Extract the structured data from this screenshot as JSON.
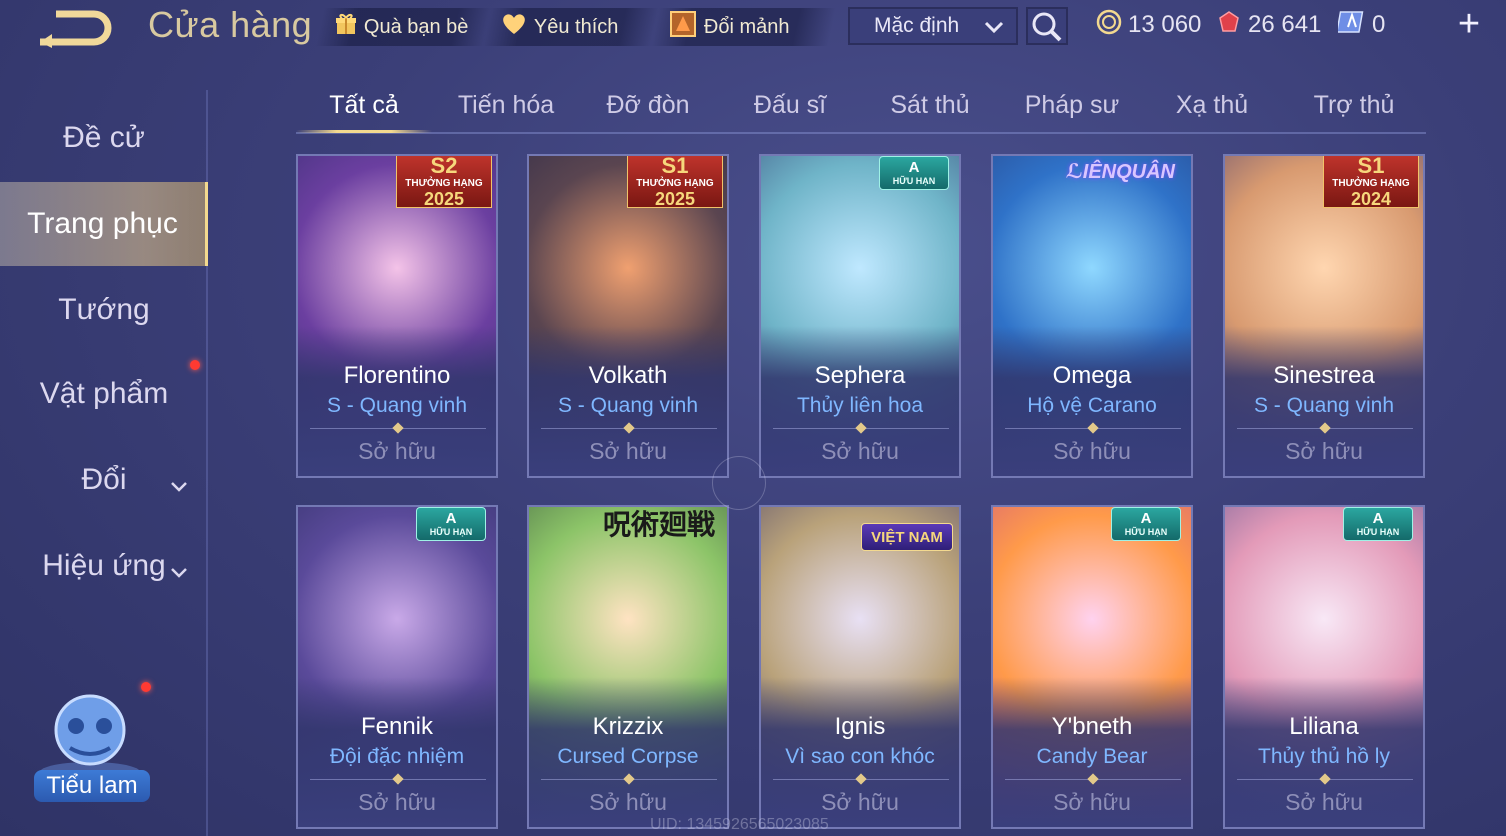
{
  "header": {
    "title": "Cửa hàng",
    "gift_label": "Quà bạn bè",
    "favorite_label": "Yêu thích",
    "exchange_label": "Đổi mảnh",
    "sort_value": "Mặc định"
  },
  "currency": {
    "gold": "13 060",
    "gems": "26 641",
    "vouchers": "0"
  },
  "sidebar": {
    "items": [
      {
        "label": "Đề cử"
      },
      {
        "label": "Trang phục"
      },
      {
        "label": "Tướng"
      },
      {
        "label": "Vật phẩm"
      },
      {
        "label": "Đổi"
      },
      {
        "label": "Hiệu ứng"
      }
    ],
    "mascot_label": "Tiểu lam"
  },
  "tabs": [
    {
      "label": "Tất cả"
    },
    {
      "label": "Tiến hóa"
    },
    {
      "label": "Đỡ đòn"
    },
    {
      "label": "Đấu sĩ"
    },
    {
      "label": "Sát thủ"
    },
    {
      "label": "Pháp sư"
    },
    {
      "label": "Xạ thủ"
    },
    {
      "label": "Trợ thủ"
    }
  ],
  "cards": [
    {
      "name": "Florentino",
      "skin": "S - Quang vinh",
      "status": "Sở hữu",
      "badge_type": "rank",
      "badge_top": "S2",
      "badge_mid": "THƯỞNG HẠNG",
      "badge_year": "2025",
      "art": [
        "#f4c3e8",
        "#6b3fa0",
        "#2a2a66"
      ]
    },
    {
      "name": "Volkath",
      "skin": "S - Quang vinh",
      "status": "Sở hữu",
      "badge_type": "rank",
      "badge_top": "S1",
      "badge_mid": "THƯỞNG HẠNG",
      "badge_year": "2025",
      "art": [
        "#f0a070",
        "#5a4550",
        "#222446"
      ]
    },
    {
      "name": "Sephera",
      "skin": "Thủy liên hoa",
      "status": "Sở hữu",
      "badge_type": "limited",
      "badge_a": "A",
      "badge_t": "HỮU HẠN",
      "art": [
        "#bfe8ff",
        "#6fb4c8",
        "#2f3a6f"
      ]
    },
    {
      "name": "Omega",
      "skin": "Hộ vệ Carano",
      "status": "Sở hữu",
      "badge_type": "lq",
      "badge_text": "ℒIÊNQUÂN",
      "art": [
        "#8fd8ff",
        "#2f72c8",
        "#273a7a"
      ]
    },
    {
      "name": "Sinestrea",
      "skin": "S - Quang vinh",
      "status": "Sở hữu",
      "badge_type": "rank",
      "badge_top": "S1",
      "badge_mid": "THƯỞNG HẠNG",
      "badge_year": "2024",
      "art": [
        "#ffd6b0",
        "#d89a70",
        "#3b3470"
      ]
    },
    {
      "name": "Fennik",
      "skin": "Đội đặc nhiệm",
      "status": "Sở hữu",
      "badge_type": "limited",
      "badge_a": "A",
      "badge_t": "HỮU HẠN",
      "art": [
        "#c9a9e8",
        "#5a4a9a",
        "#262a5a"
      ]
    },
    {
      "name": "Krizzix",
      "skin": "Cursed Corpse",
      "status": "Sở hữu",
      "badge_type": "jjk",
      "badge_text": "呪術廻戦",
      "art": [
        "#ffe3c2",
        "#8cc468",
        "#2f4a3a"
      ]
    },
    {
      "name": "Ignis",
      "skin": "Vì sao con khóc",
      "status": "Sở hữu",
      "badge_type": "vn",
      "badge_text": "VIỆT NAM",
      "art": [
        "#e8e0f4",
        "#b9a27a",
        "#3a3468"
      ]
    },
    {
      "name": "Y'bneth",
      "skin": "Candy Bear",
      "status": "Sở hữu",
      "badge_type": "limited",
      "badge_a": "A",
      "badge_t": "HỮU HẠN",
      "art": [
        "#ffd2ef",
        "#ff9a4a",
        "#c2488e"
      ]
    },
    {
      "name": "Liliana",
      "skin": "Thủy thủ hồ ly",
      "status": "Sở hữu",
      "badge_type": "limited",
      "badge_a": "A",
      "badge_t": "HỮU HẠN",
      "art": [
        "#f8e8f6",
        "#e39ab8",
        "#4a4c8c"
      ]
    }
  ],
  "footer": {
    "uid": "UID: 1345926565023085"
  },
  "colors": {
    "accent_gold": "#f3d98f",
    "skin_text": "#7fb7ff",
    "owned_text": "#8e8fb8"
  }
}
